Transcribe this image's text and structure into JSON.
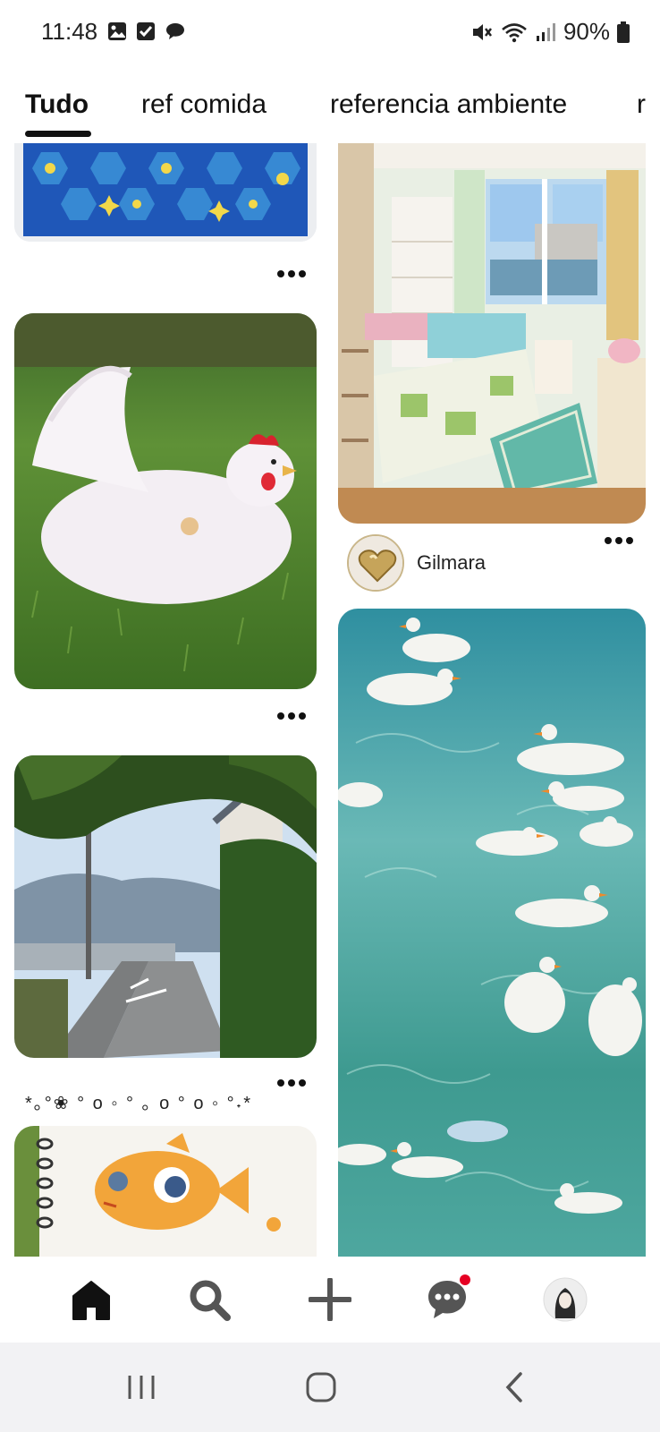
{
  "status_bar": {
    "time": "11:48",
    "battery": "90%",
    "left_icons": [
      "gallery-icon",
      "checkbox-icon",
      "chat-bubble-icon"
    ],
    "right_icons": [
      "mute-icon",
      "wifi-icon",
      "signal-icon",
      "battery-icon"
    ]
  },
  "tabs": [
    {
      "label": "Tudo",
      "active": true
    },
    {
      "label": "ref comida",
      "active": false
    },
    {
      "label": "referencia ambiente",
      "active": false
    },
    {
      "label": "r",
      "active": false
    }
  ],
  "feed": {
    "pins": [
      {
        "name": "pin-blue-tile-pattern"
      },
      {
        "name": "pin-white-chicken"
      },
      {
        "name": "pin-street-under-tree"
      },
      {
        "name": "pin-fish-drawing"
      },
      {
        "name": "pin-bedroom"
      },
      {
        "name": "pin-ducks-water"
      }
    ],
    "decorative_caption": "*｡°❀ ° o ◦ ° ｡ o ° o ◦ °˖*",
    "creator_name": "Gilmara"
  },
  "bottom_nav": [
    "home-icon",
    "search-icon",
    "create-plus-icon",
    "messages-icon",
    "profile-avatar"
  ],
  "system_nav": [
    "recent-apps-icon",
    "home-circle-icon",
    "back-icon"
  ],
  "colors": {
    "accent": "#e60023",
    "text": "#111111",
    "system_bar": "#f2f2f4"
  }
}
